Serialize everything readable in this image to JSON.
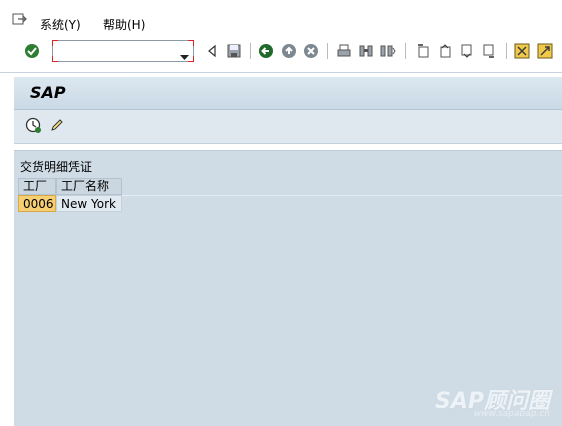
{
  "menubar": {
    "items": [
      {
        "label": "系统(Y)"
      },
      {
        "label": "帮助(H)"
      }
    ]
  },
  "toolbar": {
    "icons": [
      "enter-icon",
      "command-field",
      "back-triangle-icon",
      "save-icon",
      "back-icon",
      "exit-icon",
      "cancel-icon",
      "print-icon",
      "find-icon",
      "find-next-icon",
      "first-page-icon",
      "previous-page-icon",
      "next-page-icon",
      "last-page-icon",
      "create-session-icon",
      "shortcut-icon"
    ]
  },
  "titlebar": {
    "title": "SAP"
  },
  "list": {
    "title": "交货明细凭证",
    "columns": [
      "工厂",
      "工厂名称"
    ],
    "rows": [
      {
        "plant": "0006",
        "name": "New York"
      }
    ]
  },
  "watermark": {
    "brand": "SAP顾问圈",
    "url": "www.sapabap.cn"
  }
}
